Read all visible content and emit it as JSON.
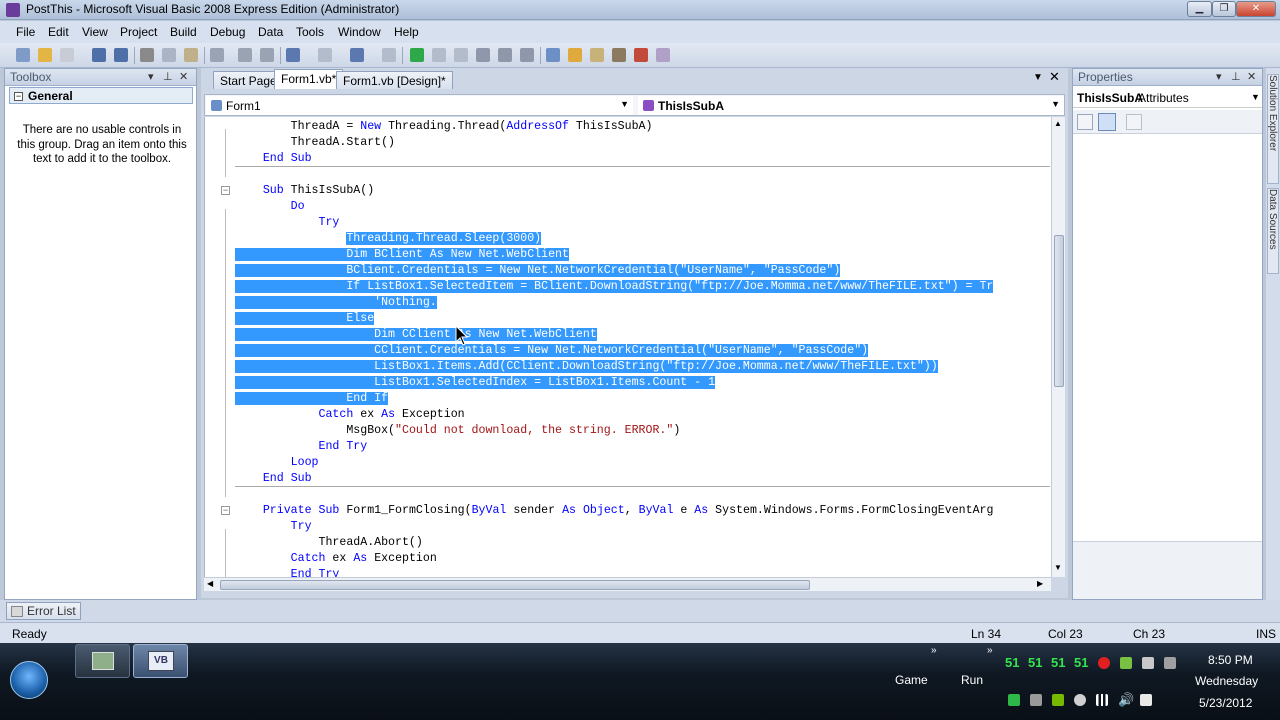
{
  "window": {
    "title": "PostThis - Microsoft Visual Basic 2008 Express Edition (Administrator)"
  },
  "menu": [
    "File",
    "Edit",
    "View",
    "Project",
    "Build",
    "Debug",
    "Data",
    "Tools",
    "Window",
    "Help"
  ],
  "toolbox": {
    "title": "Toolbox",
    "group": "General",
    "message": "There are no usable controls in this group. Drag an item onto this text to add it to the toolbox."
  },
  "tabs": [
    {
      "label": "Start Page",
      "active": false
    },
    {
      "label": "Form1.vb*",
      "active": true
    },
    {
      "label": "Form1.vb [Design]*",
      "active": false
    }
  ],
  "navbar": {
    "object": "Form1",
    "member": "ThisIsSubA"
  },
  "code_lines": [
    "        ThreadA = New Threading.Thread(AddressOf ThisIsSubA)",
    "        ThreadA.Start()",
    "    End Sub",
    "",
    "    Sub ThisIsSubA()",
    "        Do",
    "            Try",
    "                Threading.Thread.Sleep(3000)",
    "                Dim BClient As New Net.WebClient",
    "                BClient.Credentials = New Net.NetworkCredential(\"UserName\", \"PassCode\")",
    "                If ListBox1.SelectedItem = BClient.DownloadString(\"ftp://Joe.Momma.net/www/TheFILE.txt\") = Tr",
    "                    'Nothing.",
    "                Else",
    "                    Dim CClient As New Net.WebClient",
    "                    CClient.Credentials = New Net.NetworkCredential(\"UserName\", \"PassCode\")",
    "                    ListBox1.Items.Add(CClient.DownloadString(\"ftp://Joe.Momma.net/www/TheFILE.txt\"))",
    "                    ListBox1.SelectedIndex = ListBox1.Items.Count - 1",
    "                End If",
    "            Catch ex As Exception",
    "                MsgBox(\"Could not download, the string. ERROR.\")",
    "            End Try",
    "        Loop",
    "    End Sub",
    "",
    "    Private Sub Form1_FormClosing(ByVal sender As Object, ByVal e As System.Windows.Forms.FormClosingEventArg",
    "        Try",
    "            ThreadA.Abort()",
    "        Catch ex As Exception",
    "        End Try"
  ],
  "properties": {
    "title": "Properties",
    "object": "ThisIsSubA",
    "type": "Attributes"
  },
  "side_tabs": [
    "Solution Explorer",
    "Data Sources"
  ],
  "error_list": "Error List",
  "status": {
    "ready": "Ready",
    "ln": "Ln 34",
    "col": "Col 23",
    "ch": "Ch 23",
    "mode": "INS"
  },
  "taskbar": {
    "game": "Game",
    "run": "Run",
    "meters": [
      "51",
      "51",
      "51",
      "51"
    ],
    "time": "8:50 PM",
    "day": "Wednesday",
    "date": "5/23/2012"
  },
  "colors": {
    "selection": "#3399ff",
    "keyword": "#0000ff",
    "string": "#a31515"
  }
}
